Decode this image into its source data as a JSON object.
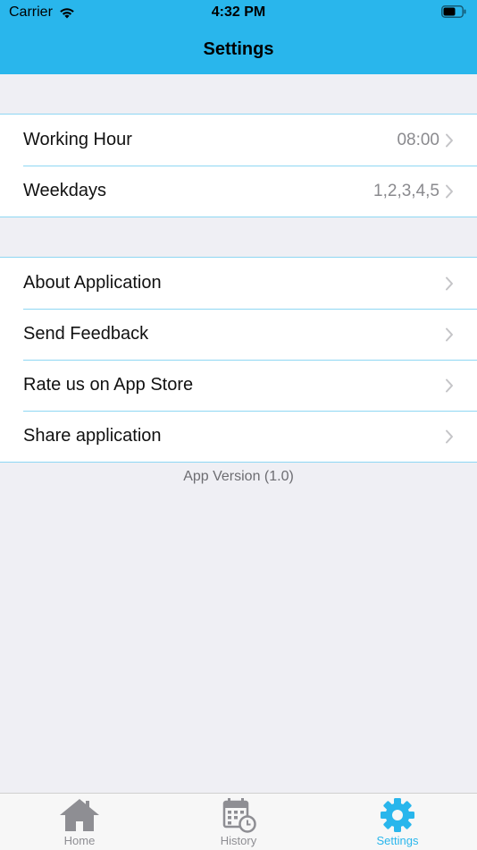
{
  "status_bar": {
    "carrier": "Carrier",
    "time": "4:32 PM"
  },
  "nav": {
    "title": "Settings"
  },
  "group1": {
    "items": [
      {
        "label": "Working Hour",
        "value": "08:00"
      },
      {
        "label": "Weekdays",
        "value": "1,2,3,4,5"
      }
    ]
  },
  "group2": {
    "items": [
      {
        "label": "About Application"
      },
      {
        "label": "Send Feedback"
      },
      {
        "label": "Rate us on App Store"
      },
      {
        "label": "Share application"
      }
    ]
  },
  "footer": {
    "version": "App Version (1.0)"
  },
  "tab_bar": {
    "tabs": [
      {
        "label": "Home",
        "icon": "home-icon"
      },
      {
        "label": "History",
        "icon": "calendar-clock-icon"
      },
      {
        "label": "Settings",
        "icon": "gear-icon",
        "active": true
      }
    ]
  },
  "colors": {
    "accent": "#29B6EC",
    "separator": "#8ED7F3",
    "background": "#EFEFF4"
  }
}
